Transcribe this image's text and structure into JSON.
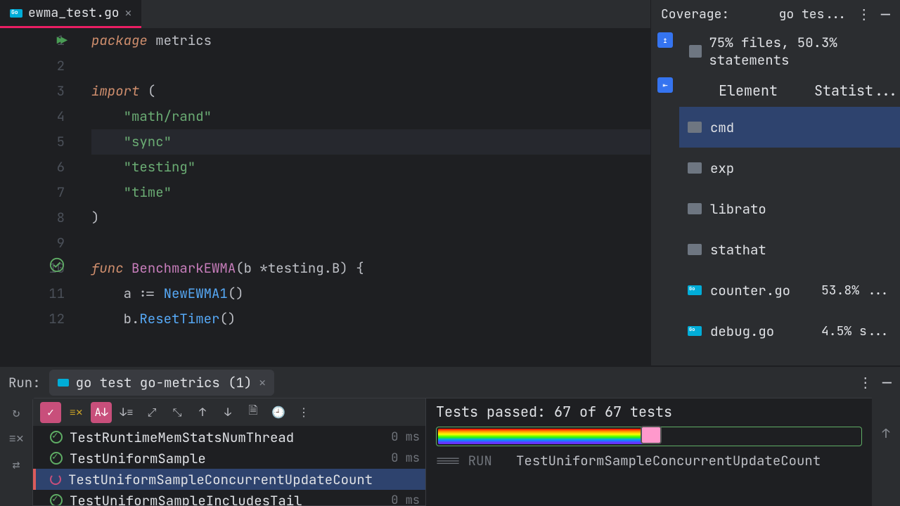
{
  "tab": {
    "filename": "ewma_test.go"
  },
  "editor": {
    "lines": [
      {
        "n": 1,
        "segments": [
          {
            "t": "package ",
            "c": "kw"
          },
          {
            "t": "metrics",
            "c": "ident"
          }
        ]
      },
      {
        "n": 2,
        "segments": []
      },
      {
        "n": 3,
        "segments": [
          {
            "t": "import ",
            "c": "kw"
          },
          {
            "t": "(",
            "c": "ident"
          }
        ]
      },
      {
        "n": 4,
        "segments": [
          {
            "t": "    \"math/rand\"",
            "c": "str"
          }
        ]
      },
      {
        "n": 5,
        "segments": [
          {
            "t": "    \"sync\"",
            "c": "str"
          }
        ],
        "hl": true
      },
      {
        "n": 6,
        "segments": [
          {
            "t": "    \"testing\"",
            "c": "str"
          }
        ]
      },
      {
        "n": 7,
        "segments": [
          {
            "t": "    \"time\"",
            "c": "str"
          }
        ]
      },
      {
        "n": 8,
        "segments": [
          {
            "t": ")",
            "c": "ident"
          }
        ]
      },
      {
        "n": 9,
        "segments": []
      },
      {
        "n": 10,
        "segments": [
          {
            "t": "func ",
            "c": "kw"
          },
          {
            "t": "BenchmarkEWMA",
            "c": "fnname"
          },
          {
            "t": "(b *testing.B) {",
            "c": "ident"
          }
        ]
      },
      {
        "n": 11,
        "segments": [
          {
            "t": "    a := ",
            "c": "ident"
          },
          {
            "t": "NewEWMA1",
            "c": "fn"
          },
          {
            "t": "()",
            "c": "ident"
          }
        ]
      },
      {
        "n": 12,
        "segments": [
          {
            "t": "    b.",
            "c": "ident"
          },
          {
            "t": "ResetTimer",
            "c": "fn"
          },
          {
            "t": "()",
            "c": "ident"
          }
        ]
      }
    ]
  },
  "coverage": {
    "title": "Coverage:",
    "run_config": "go tes...",
    "summary": "75% files, 50.3% statements",
    "columns": {
      "element": "Element",
      "stat": "Statist..."
    },
    "items": [
      {
        "kind": "folder",
        "name": "cmd",
        "stat": "",
        "selected": true
      },
      {
        "kind": "folder",
        "name": "exp",
        "stat": ""
      },
      {
        "kind": "folder",
        "name": "librato",
        "stat": ""
      },
      {
        "kind": "folder",
        "name": "stathat",
        "stat": ""
      },
      {
        "kind": "gofile",
        "name": "counter.go",
        "stat": "53.8% ..."
      },
      {
        "kind": "gofile",
        "name": "debug.go",
        "stat": "4.5% s..."
      }
    ]
  },
  "run": {
    "label": "Run:",
    "tab_name": "go test go-metrics (1)",
    "tests_passed": {
      "prefix": "Tests passed: ",
      "count": "67",
      "mid": " of ",
      "total": "67",
      "suffix": " tests"
    },
    "tests": [
      {
        "status": "ok",
        "name": "TestRuntimeMemStatsNumThread",
        "time": "0 ms"
      },
      {
        "status": "ok",
        "name": "TestUniformSample",
        "time": "0 ms"
      },
      {
        "status": "running",
        "name": "TestUniformSampleConcurrentUpdateCount",
        "time": "",
        "selected": true
      },
      {
        "status": "ok",
        "name": "TestUniformSampleIncludesTail",
        "time": "0 ms"
      }
    ],
    "console": {
      "prefix": "=== RUN   ",
      "test": "TestUniformSampleConcurrentUpdateCount"
    }
  }
}
